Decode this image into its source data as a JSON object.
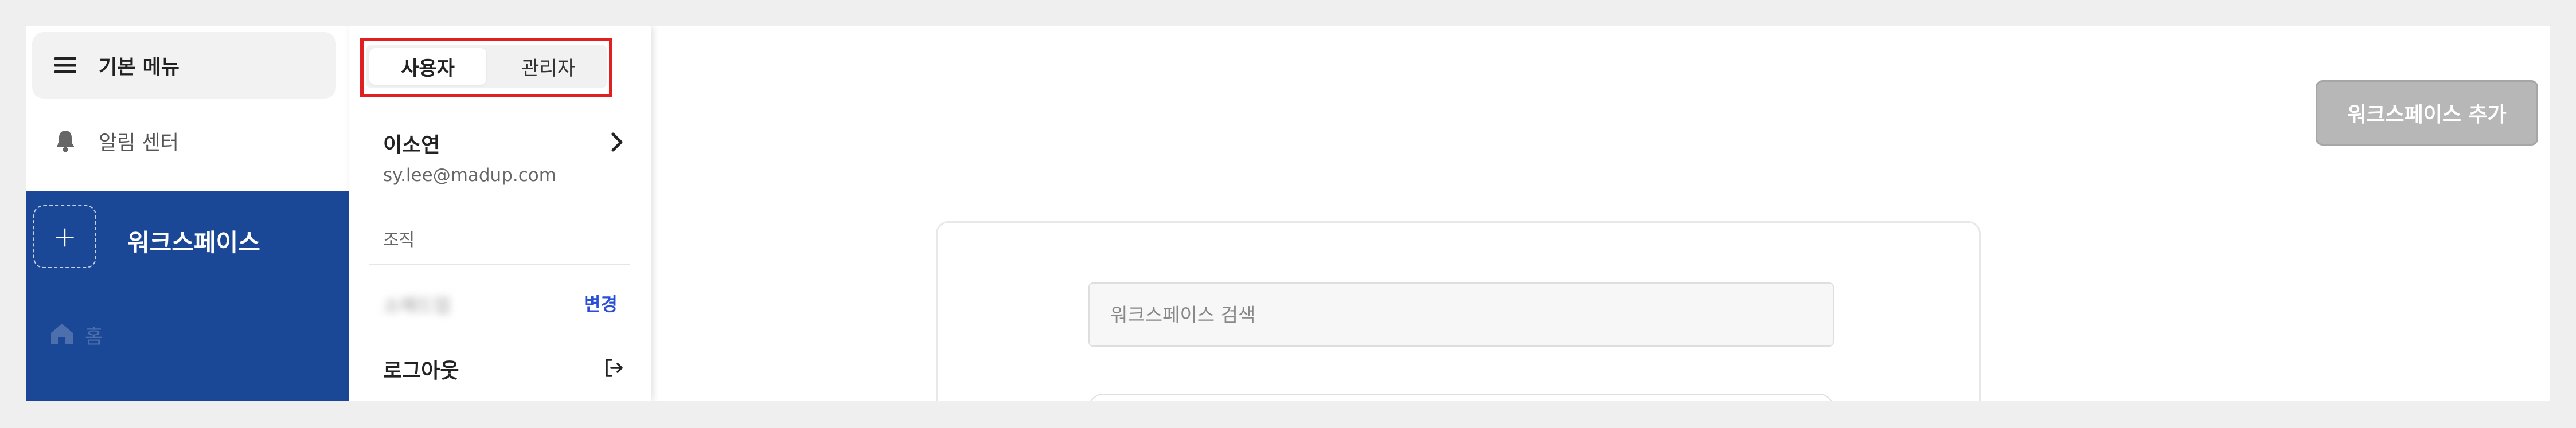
{
  "sidebar": {
    "menu_label": "기본 메뉴",
    "alarm_label": "알림 센터",
    "workspace_title": "워크스페이스",
    "add_icon": "+",
    "home_label": "홈"
  },
  "popup": {
    "tabs": [
      {
        "label": "사용자",
        "active": true
      },
      {
        "label": "관리자",
        "active": false
      }
    ],
    "user_name": "이소연",
    "user_email": "sy.lee@madup.com",
    "org_label": "조직",
    "org_name": "소매드업",
    "change_label": "변경",
    "logout_label": "로그아웃",
    "highlight_color": "#e02020"
  },
  "main": {
    "add_workspace_label": "워크스페이스 추가",
    "search_placeholder": "워크스페이스 검색",
    "panel_color": "#1b4896",
    "link_color": "#2a4fd6"
  },
  "icons": {
    "menu": "hamburger-icon",
    "alarm": "bell-icon",
    "home": "home-icon",
    "user_arrow": "chevron-right-icon",
    "logout": "logout-icon"
  }
}
